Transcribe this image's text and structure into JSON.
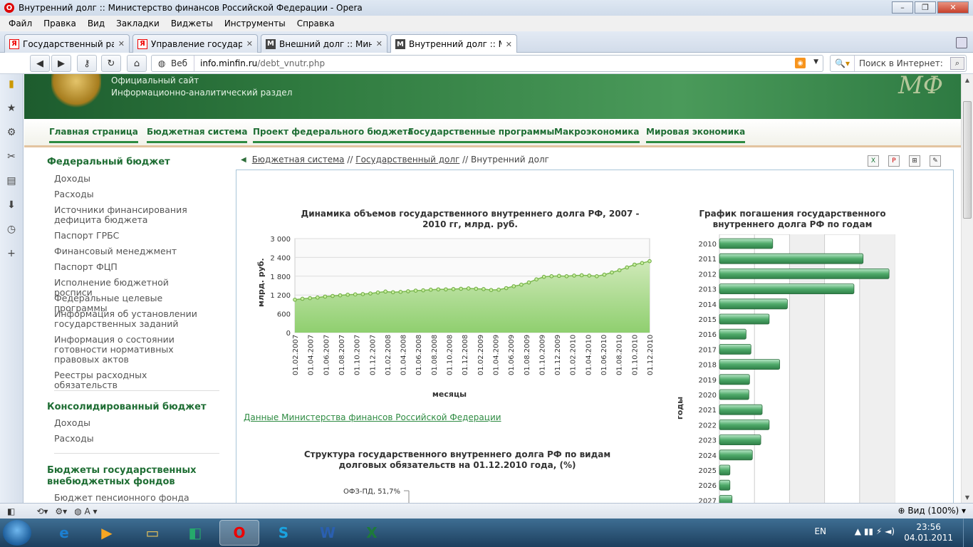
{
  "window": {
    "title": "Внутренний долг :: Министерство финансов Российской Федерации - Opera"
  },
  "menu": [
    "Файл",
    "Правка",
    "Вид",
    "Закладки",
    "Виджеты",
    "Инструменты",
    "Справка"
  ],
  "tabs": [
    {
      "label": "Государственный рас...",
      "icon": "yandex-icon"
    },
    {
      "label": "Управление государс...",
      "icon": "yandex-icon"
    },
    {
      "label": "Внешний долг :: Мин...",
      "icon": "minfin-icon"
    },
    {
      "label": "Внутренний долг :: М...",
      "icon": "minfin-icon"
    }
  ],
  "address": {
    "mode": "Веб",
    "host": "info.minfin.ru",
    "path": "/debt_vnutr.php"
  },
  "search": {
    "placeholder": "Поиск в Интернет: Поиск"
  },
  "site": {
    "line1": "Официальный сайт",
    "line2": "Информационно-аналитический раздел",
    "logo": "МФ"
  },
  "topnav": [
    "Главная страница",
    "Бюджетная система",
    "Проект федерального бюджета",
    "Государственные программы",
    "Макроэкономика",
    "Мировая экономика"
  ],
  "sidebar": {
    "h1": "Федеральный бюджет",
    "items1": [
      "Доходы",
      "Расходы",
      "Источники финансирования дефицита бюджета",
      "Паспорт ГРБС",
      "Финансовый менеджмент",
      "Паспорт ФЦП",
      "Исполнение бюджетной росписи",
      "Федеральные целевые программы",
      "Информация об установлении государственных заданий",
      "Информация о состоянии готовности нормативных правовых актов",
      "Реестры расходных обязательств"
    ],
    "h2": "Консолидированный бюджет",
    "items2": [
      "Доходы",
      "Расходы"
    ],
    "h3": "Бюджеты государственных внебюджетных фондов",
    "items3": [
      "Бюджет пенсионного фонда РФ"
    ]
  },
  "breadcrumb": {
    "a": "Бюджетная система",
    "sep": " // ",
    "b": "Государственный долг",
    "c": "Внутренний долг"
  },
  "source_link": "Данные Министерства финансов Российской Федерации",
  "status": {
    "zoom": "Вид (100%)"
  },
  "taskbar": {
    "lang": "EN",
    "time": "23:56",
    "date": "04.01.2011"
  },
  "chart_data": [
    {
      "type": "area",
      "title": "Динамика объемов государственного внутреннего долга РФ, 2007 - 2010 гг, млрд. руб.",
      "xlabel": "месяцы",
      "ylabel": "млрд. руб.",
      "ylim": [
        0,
        3000
      ],
      "yticks": [
        "0",
        "600",
        "1 200",
        "1 800",
        "2 400",
        "3 000"
      ],
      "xticks": [
        "01.02.2007",
        "01.04.2007",
        "01.06.2007",
        "01.08.2007",
        "01.10.2007",
        "01.12.2007",
        "01.02.2008",
        "01.04.2008",
        "01.06.2008",
        "01.08.2008",
        "01.10.2008",
        "01.12.2008",
        "01.02.2009",
        "01.04.2009",
        "01.06.2009",
        "01.08.2009",
        "01.10.2009",
        "01.12.2009",
        "01.02.2010",
        "01.04.2010",
        "01.06.2010",
        "01.08.2010",
        "01.10.2010",
        "01.12.2010"
      ],
      "values": [
        1050,
        1080,
        1100,
        1120,
        1150,
        1170,
        1190,
        1210,
        1220,
        1230,
        1250,
        1280,
        1310,
        1290,
        1300,
        1320,
        1340,
        1350,
        1370,
        1380,
        1380,
        1390,
        1400,
        1410,
        1400,
        1390,
        1360,
        1370,
        1420,
        1480,
        1530,
        1600,
        1700,
        1780,
        1800,
        1810,
        1800,
        1820,
        1830,
        1820,
        1800,
        1850,
        1920,
        1990,
        2080,
        2170,
        2220,
        2280
      ],
      "grid": true
    },
    {
      "type": "bar",
      "orientation": "horizontal",
      "title": "График погашения государственного внутреннего долга РФ по годам",
      "ylabel": "годы",
      "categories": [
        "2010",
        "2011",
        "2012",
        "2013",
        "2014",
        "2015",
        "2016",
        "2017",
        "2018",
        "2019",
        "2020",
        "2021",
        "2022",
        "2023",
        "2024",
        "2025",
        "2026",
        "2027"
      ],
      "values": [
        76,
        205,
        242,
        192,
        97,
        71,
        38,
        45,
        86,
        43,
        42,
        61,
        71,
        59,
        47,
        15,
        15,
        18
      ]
    },
    {
      "type": "pie",
      "title": "Структура государственного внутреннего долга РФ по видам долговых обязательств на 01.12.2010  года, (%)",
      "labels": [
        "ОФЗ-ПД, 51,7%"
      ],
      "values": [
        51.7
      ]
    }
  ]
}
